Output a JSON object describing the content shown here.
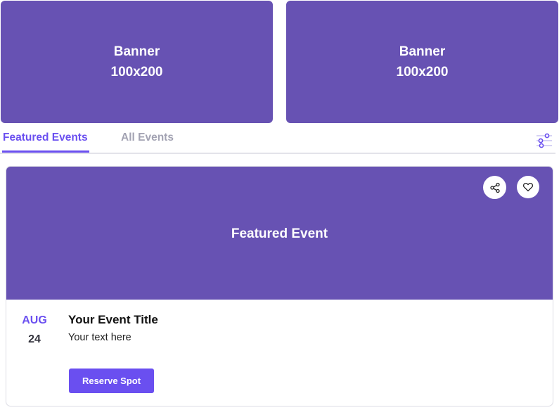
{
  "banners": [
    {
      "line1": "Banner",
      "line2": "100x200"
    },
    {
      "line1": "Banner",
      "line2": "100x200"
    }
  ],
  "tabs": {
    "featured": "Featured Events",
    "all": "All Events",
    "active": "featured"
  },
  "card": {
    "hero_title": "Featured Event",
    "date_month": "AUG",
    "date_day": "24",
    "event_title": "Your Event Title",
    "event_text": "Your text here",
    "reserve_label": "Reserve Spot"
  },
  "icons": {
    "share": "share-icon",
    "like": "heart-icon",
    "filter": "filter-sliders-icon"
  },
  "colors": {
    "banner": "#6752b3",
    "accent": "#6a4ff0",
    "tab_inactive": "#a3a3b3"
  }
}
